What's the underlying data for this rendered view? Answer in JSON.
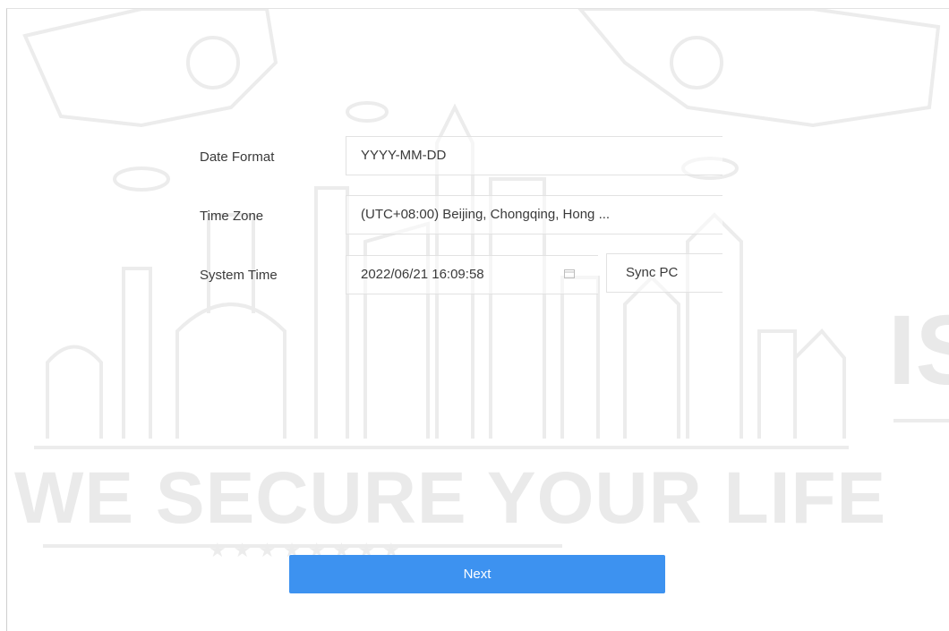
{
  "form": {
    "date_format": {
      "label": "Date Format",
      "value": "YYYY-MM-DD"
    },
    "time_zone": {
      "label": "Time Zone",
      "value": "(UTC+08:00) Beijing, Chongqing, Hong ..."
    },
    "system_time": {
      "label": "System Time",
      "value": "2022/06/21 16:09:58",
      "icon": "calendar-icon"
    },
    "sync_pc_label": "Sync PC"
  },
  "actions": {
    "next_label": "Next"
  },
  "watermark": {
    "slogan": "WE SECURE YOUR LIFE",
    "side_fragment": "IS"
  },
  "colors": {
    "accent": "#3d92f0",
    "watermark": "#eaeaea",
    "border": "#e2e2e2"
  }
}
